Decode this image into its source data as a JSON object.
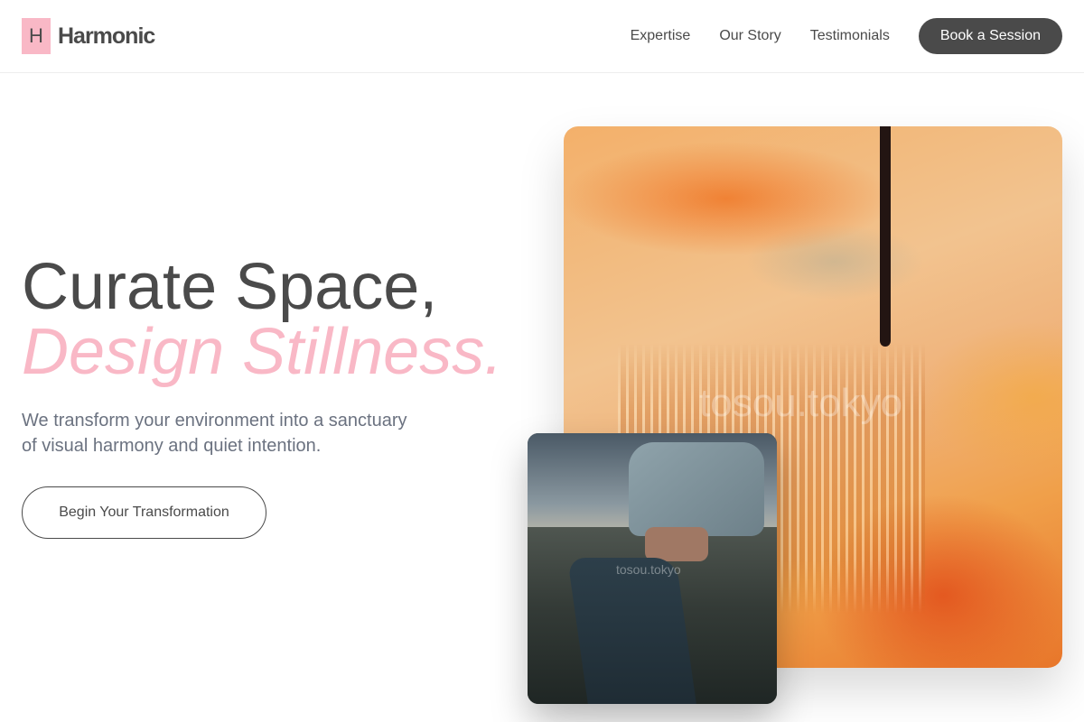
{
  "header": {
    "logo_letter": "H",
    "brand_name": "Harmonic",
    "nav": [
      {
        "label": "Expertise"
      },
      {
        "label": "Our Story"
      },
      {
        "label": "Testimonials"
      }
    ],
    "cta_label": "Book a Session"
  },
  "hero": {
    "title_line1": "Curate Space,",
    "title_line2": "Design Stillness.",
    "subtitle": "We transform your environment into a sanctuary of visual harmony and quiet intention.",
    "cta_label": "Begin Your Transformation"
  },
  "images": {
    "main_watermark": "tosou.tokyo",
    "secondary_watermark": "tosou.tokyo"
  },
  "colors": {
    "accent": "#f9b8c6",
    "text": "#4a4a4a",
    "muted": "#6b7280"
  }
}
